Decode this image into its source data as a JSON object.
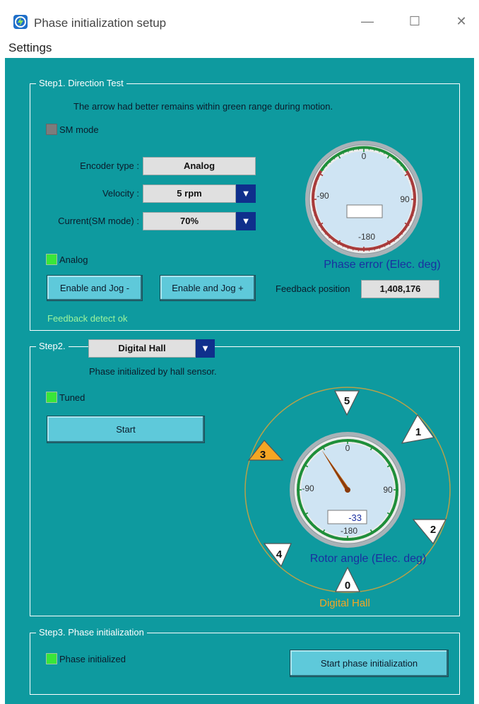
{
  "window": {
    "title": "Phase initialization setup",
    "minimize": "—",
    "maximize": "☐",
    "close": "✕"
  },
  "menu": {
    "settings": "Settings"
  },
  "step1": {
    "title": "Step1. Direction Test",
    "instruction": "The arrow had better remains within green range during motion.",
    "sm_mode_label": "SM mode",
    "encoder_type_label": "Encoder type :",
    "encoder_type_value": "Analog",
    "velocity_label": "Velocity :",
    "velocity_value": "5 rpm",
    "current_label": "Current(SM mode) :",
    "current_value": "70%",
    "analog_label": "Analog",
    "jog_minus": "Enable and Jog -",
    "jog_plus": "Enable and Jog +",
    "feedback_status": "Feedback detect ok",
    "feedback_position_label": "Feedback position",
    "feedback_position_value": "1,408,176",
    "gauge": {
      "caption": "Phase error (Elec. deg)",
      "ticks": [
        "0",
        "90",
        "-180",
        "-90"
      ],
      "readout": ""
    }
  },
  "step2": {
    "title": "Step2.",
    "mode_value": "Digital Hall",
    "description": "Phase initialized by hall sensor.",
    "tuned_label": "Tuned",
    "start_button": "Start",
    "gauge": {
      "caption": "Rotor angle (Elec. deg)",
      "ticks": [
        "0",
        "90",
        "-180",
        "-90"
      ],
      "readout": "-33",
      "needle_deg": -33
    },
    "hall_caption": "Digital Hall",
    "hall_sectors": [
      "5",
      "1",
      "2",
      "0",
      "4",
      "3"
    ],
    "active_sector": "3"
  },
  "step3": {
    "title": "Step3. Phase initialization",
    "initialized_label": "Phase initialized",
    "start_button": "Start phase initialization"
  },
  "colors": {
    "background": "#0e9a9f",
    "button": "#5ec9da",
    "dropdown_arrow": "#0f2f8c",
    "led_on": "#39e639",
    "led_off": "#7c7c7c",
    "gauge_green": "#1f8f3a",
    "gauge_red": "#a83b3b",
    "hall_active": "#f5a623",
    "hall_ring": "#b7a14a",
    "status_text": "#9df59d",
    "caption_blue": "#1a2fa0"
  }
}
